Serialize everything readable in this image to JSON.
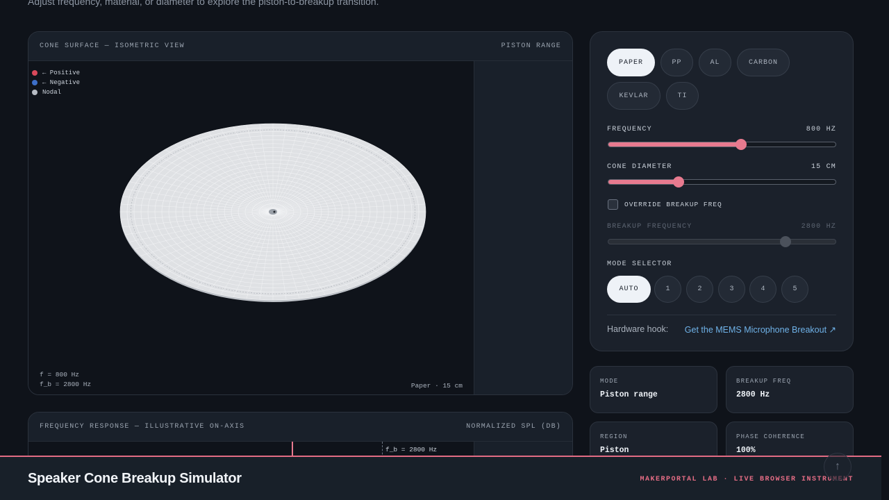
{
  "intro": {
    "subtitle": "Adjust frequency, material, or diameter to explore the piston-to-breakup transition."
  },
  "cone_panel": {
    "title": "CONE SURFACE — ISOMETRIC VIEW",
    "status": "PISTON RANGE",
    "legend": [
      {
        "label": "← Positive",
        "color": "#d9495b"
      },
      {
        "label": "← Negative",
        "color": "#3d6fc9"
      },
      {
        "label": "Nodal",
        "color": "#b7bcc4"
      }
    ],
    "readout_freq": "f = 800 Hz",
    "readout_breakup": "f_b = 2800 Hz",
    "readout_material": "Paper · 15 cm"
  },
  "freq_panel": {
    "title": "FREQUENCY RESPONSE — ILLUSTRATIVE ON-AXIS",
    "axis_label": "NORMALIZED SPL (DB)",
    "breakup_marker": "f_b = 2800 Hz"
  },
  "controls": {
    "materials": [
      "PAPER",
      "PP",
      "AL",
      "CARBON",
      "KEVLAR",
      "TI"
    ],
    "selected_material": "PAPER",
    "frequency": {
      "label": "FREQUENCY",
      "value_text": "800 HZ",
      "fraction": 0.585
    },
    "diameter": {
      "label": "CONE DIAMETER",
      "value_text": "15 CM",
      "fraction": 0.31
    },
    "override": {
      "label": "OVERRIDE BREAKUP FREQ",
      "checked": false
    },
    "breakup": {
      "label": "BREAKUP FREQUENCY",
      "value_text": "2800 HZ",
      "fraction": 0.78
    },
    "mode_selector": {
      "label": "MODE SELECTOR",
      "auto": "AUTO",
      "modes": [
        "1",
        "2",
        "3",
        "4",
        "5"
      ]
    },
    "hardware_label": "Hardware hook:",
    "hardware_link": "Get the MEMS Microphone Breakout ↗"
  },
  "stats": {
    "mode": {
      "label": "MODE",
      "value": "Piston range"
    },
    "breakup_freq": {
      "label": "BREAKUP FREQ",
      "value": "2800 Hz"
    },
    "region": {
      "label": "REGION",
      "value": "Piston"
    },
    "phase": {
      "label": "PHASE COHERENCE",
      "value": "100%"
    }
  },
  "footer": {
    "title": "Speaker Cone Breakup Simulator",
    "brand": "MAKERPORTAL LAB · LIVE BROWSER INSTRUMENT"
  },
  "colors": {
    "accent": "#e87a8f",
    "link": "#6fb2e8",
    "background": "#0f131a"
  },
  "icons": {
    "scroll_top": "arrow-up-icon"
  }
}
